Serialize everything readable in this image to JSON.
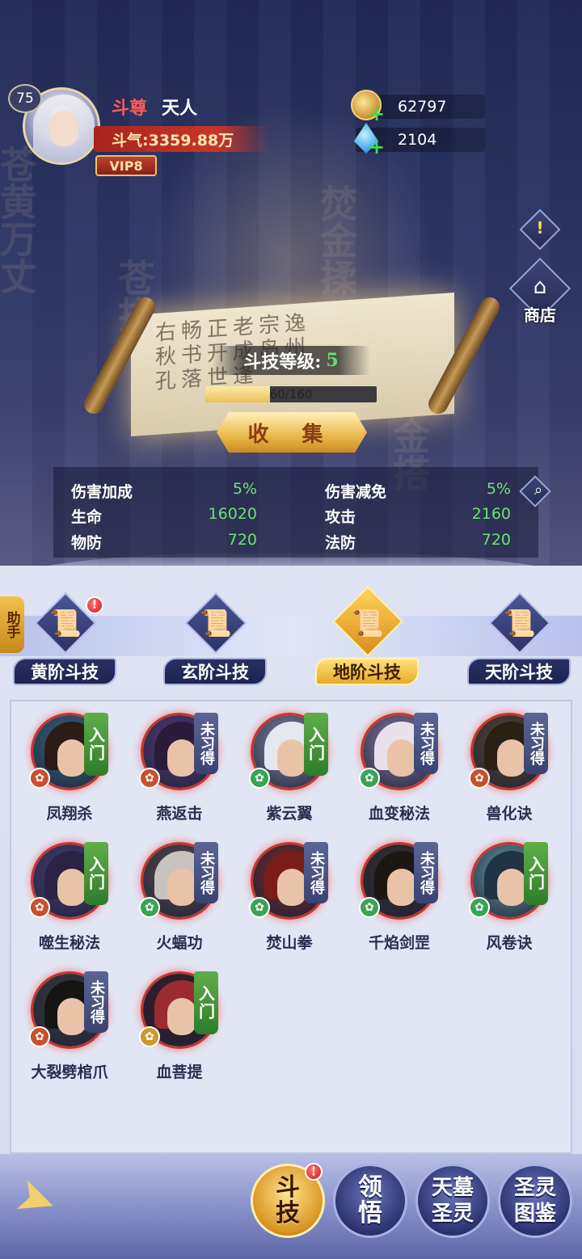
{
  "header": {
    "level": "75",
    "rank": "斗尊",
    "rank_sub": "天人",
    "power_label": "斗气:3359.88万",
    "vip": "VIP8"
  },
  "currency": {
    "gold": "62797",
    "gems": "2104"
  },
  "side": {
    "alert_icon": "!",
    "shop_label": "商店"
  },
  "scroll": {
    "skill_level_label": "斗技等级:",
    "skill_level_value": "5",
    "progress_text": "60/160",
    "progress_fraction": 0.375,
    "collect_label": "收 集"
  },
  "stats": {
    "items": [
      {
        "label": "伤害加成",
        "value": "5%"
      },
      {
        "label": "伤害减免",
        "value": "5%"
      },
      {
        "label": "生命",
        "value": "16020"
      },
      {
        "label": "攻击",
        "value": "2160"
      },
      {
        "label": "物防",
        "value": "720"
      },
      {
        "label": "法防",
        "value": "720"
      }
    ]
  },
  "helper_label": "助手",
  "tabs": [
    {
      "label": "黄阶斗技",
      "active": false,
      "alert": "!"
    },
    {
      "label": "玄阶斗技",
      "active": false
    },
    {
      "label": "地阶斗技",
      "active": true
    },
    {
      "label": "天阶斗技",
      "active": false
    }
  ],
  "heroes": [
    {
      "name": "凤翔杀",
      "tag": "入门",
      "learned": true,
      "type_color": "#c8502c"
    },
    {
      "name": "燕返击",
      "tag": "未习得",
      "learned": false,
      "type_color": "#c8502c"
    },
    {
      "name": "紫云翼",
      "tag": "入门",
      "learned": true,
      "type_color": "#3aa357"
    },
    {
      "name": "血变秘法",
      "tag": "未习得",
      "learned": false,
      "type_color": "#3aa357"
    },
    {
      "name": "兽化诀",
      "tag": "未习得",
      "learned": false,
      "type_color": "#c8502c"
    },
    {
      "name": "噬生秘法",
      "tag": "入门",
      "learned": true,
      "type_color": "#c8502c"
    },
    {
      "name": "火蝠功",
      "tag": "未习得",
      "learned": false,
      "type_color": "#3aa357"
    },
    {
      "name": "焚山拳",
      "tag": "未习得",
      "learned": false,
      "type_color": "#3aa357"
    },
    {
      "name": "千焰剑罡",
      "tag": "未习得",
      "learned": false,
      "type_color": "#3aa357"
    },
    {
      "name": "风卷诀",
      "tag": "入门",
      "learned": true,
      "type_color": "#3aa357"
    },
    {
      "name": "大裂劈棺爪",
      "tag": "未习得",
      "learned": false,
      "type_color": "#c8502c"
    },
    {
      "name": "血菩提",
      "tag": "入门",
      "learned": true,
      "type_color": "#c99a2e"
    }
  ],
  "nav": [
    {
      "label_top": "斗",
      "label_bottom": "技",
      "active": true,
      "alert": "!"
    },
    {
      "label_top": "领",
      "label_bottom": "悟",
      "active": false
    },
    {
      "label_top": "天墓",
      "label_bottom": "圣灵",
      "active": false
    },
    {
      "label_top": "圣灵",
      "label_bottom": "图鉴",
      "active": false
    }
  ]
}
